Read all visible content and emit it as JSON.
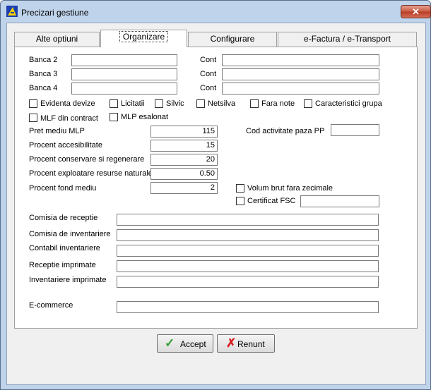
{
  "window": {
    "title": "Precizari gestiune",
    "close_glyph": "✕"
  },
  "tabs": [
    {
      "label": "Alte optiuni"
    },
    {
      "label": "Organizare"
    },
    {
      "label": "Configurare"
    },
    {
      "label": "e-Factura / e-Transport"
    }
  ],
  "bank": {
    "rows": [
      {
        "label": "Banca 2",
        "cont_label": "Cont",
        "bank_value": "",
        "cont_value": ""
      },
      {
        "label": "Banca 3",
        "cont_label": "Cont",
        "bank_value": "",
        "cont_value": ""
      },
      {
        "label": "Banca 4",
        "cont_label": "Cont",
        "bank_value": "",
        "cont_value": ""
      }
    ]
  },
  "checkboxes": {
    "evidenta_devize": "Evidenta devize",
    "licitatii": "Licitatii",
    "silvic": "Silvic",
    "netsilva": "Netsilva",
    "fara_note": "Fara note",
    "caracteristici": "Caracteristici grupa",
    "mlf_contract": "MLF din contract",
    "mlp_esalonat": "MLP esalonat",
    "volum_brut": "Volum brut fara zecimale",
    "certificat_fsc": "Certificat FSC"
  },
  "percent": {
    "pret_mediu": {
      "label": "Pret mediu  MLP",
      "value": "115"
    },
    "accesibilitate": {
      "label": "Procent accesibilitate",
      "value": "15"
    },
    "conservare": {
      "label": "Procent conservare si regenerare",
      "value": "20"
    },
    "exploatare": {
      "label": "Procent exploatare resurse naturale",
      "value": "0.50"
    },
    "fond_mediu": {
      "label": "Procent fond mediu",
      "value": "2"
    }
  },
  "cod_activitate": {
    "label": "Cod activitate paza PP",
    "value": ""
  },
  "fsc_value": "",
  "commissions": [
    {
      "label": "Comisia de receptie",
      "value": ""
    },
    {
      "label": "Comisia de inventariere",
      "value": ""
    },
    {
      "label": "Contabil inventariere",
      "value": ""
    },
    {
      "label": "Receptie imprimate",
      "value": ""
    },
    {
      "label": "Inventariere imprimate",
      "value": ""
    }
  ],
  "ecommerce": {
    "label": "E-commerce",
    "value": ""
  },
  "buttons": {
    "accept": {
      "label": "Accept",
      "icon": "check-icon",
      "color": "#2e9e2e"
    },
    "renunt": {
      "label": "Renunt",
      "icon": "x-icon",
      "color": "#d42020"
    }
  }
}
